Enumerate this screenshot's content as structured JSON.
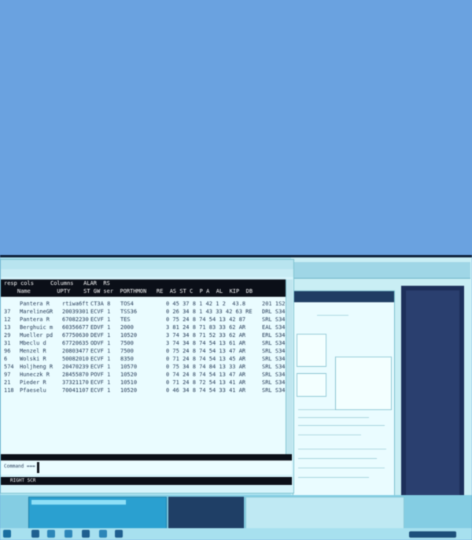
{
  "terminal": {
    "title": "",
    "header_row_1": "resp cols     Columns   ALAR  RS",
    "header_row_2": "    Name        UPTY    ST GW ser  PORTHMON   RE  AS ST C  P A  AL  KIP  DB",
    "rows": [
      {
        "id": "",
        "name": "Pantera R",
        "code": "rtiwa6ft",
        "st": "CT3A 8",
        "port": "TOS4",
        "vals": "0 45 37 8 1 42 1 2  43.8",
        "tail": "201 1S2"
      },
      {
        "id": "37",
        "name": "MarelineGR",
        "code": "20039301",
        "st": "ECVF 1",
        "port": "TSS36",
        "vals": "0 26 34 8 1 43 33 42 63 RE",
        "tail": "DRL S34"
      },
      {
        "id": "12",
        "name": "Pantera R",
        "code": "67082230",
        "st": "ECVF 1",
        "port": "TES",
        "vals": "0 75 24 8 74 54 13 42 87",
        "tail": "SRL S34"
      },
      {
        "id": "13",
        "name": "Berghuic m",
        "code": "60356677",
        "st": "EDVF 1",
        "port": "2000",
        "vals": "3 81 24 8 71 83 33 62 AR",
        "tail": "EAL S34"
      },
      {
        "id": "29",
        "name": "Mueller pd",
        "code": "67750630",
        "st": "DEVF 1",
        "port": "10520",
        "vals": "3 74 34 8 71 52 33 62 AR",
        "tail": "ERL S34"
      },
      {
        "id": "31",
        "name": "Mbeclu d",
        "code": "67720635",
        "st": "ODVF 1",
        "port": "7500",
        "vals": "3 74 34 8 74 54 13 61 AR",
        "tail": "SRL S34"
      },
      {
        "id": "96",
        "name": "Menzel R",
        "code": "20803477",
        "st": "ECVF 1",
        "port": "7500",
        "vals": "0 75 24 8 74 54 13 47 AR",
        "tail": "SRL S34"
      },
      {
        "id": "6",
        "name": "Wolski R",
        "code": "50082010",
        "st": "ECVF 1",
        "port": "8350",
        "vals": "0 71 24 8 74 54 13 45 AR",
        "tail": "SRL S34"
      },
      {
        "id": "574",
        "name": "Holjheng R",
        "code": "20470239",
        "st": "ECVF 1",
        "port": "10570",
        "vals": "0 75 34 8 74 84 13 33 AR",
        "tail": "SRL S34"
      },
      {
        "id": "97",
        "name": "Huneczk R",
        "code": "28455870",
        "st": "POVF 1",
        "port": "10520",
        "vals": "0 74 24 8 74 54 13 47 AR",
        "tail": "SRL S34"
      },
      {
        "id": "21",
        "name": "Pieder R",
        "code": "37321170",
        "st": "ECVF 1",
        "port": "10510",
        "vals": "0 71 24 8 72 54 13 41 AR",
        "tail": "SRL S34"
      },
      {
        "id": "118",
        "name": "Pfaeselu",
        "code": "70041107",
        "st": "ECVF 1",
        "port": "10520",
        "vals": "0 46 34 8 74 54 33 41 AR",
        "tail": "SRL S34"
      }
    ],
    "command_prompt": "Command ===",
    "bottom_bar_text": "RIGHT SCR"
  },
  "colors": {
    "wall": "#6aa2e0",
    "screen": "#aee4f0",
    "terminal_header": "#0b0f18",
    "taskbar_accent": "#2aa0d0"
  }
}
